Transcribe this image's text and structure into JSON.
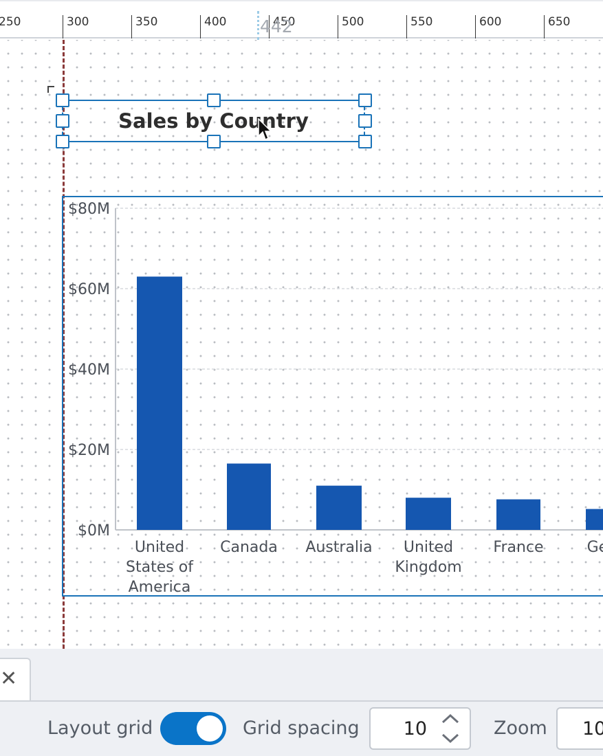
{
  "ruler": {
    "ticks": [
      "250",
      "300",
      "350",
      "400",
      "450",
      "500",
      "550",
      "600",
      "650"
    ],
    "cursor_readout": "442"
  },
  "title_element": {
    "text": "Sales by Country"
  },
  "chart_data": {
    "type": "bar",
    "title": "Sales by Country",
    "categories": [
      "United States of America",
      "Canada",
      "Australia",
      "United Kingdom",
      "France",
      "Germany"
    ],
    "category_lines": [
      [
        "United",
        "States of",
        "America"
      ],
      [
        "Canada"
      ],
      [
        "Australia"
      ],
      [
        "United",
        "Kingdom"
      ],
      [
        "France"
      ],
      [
        "Germ"
      ]
    ],
    "values": [
      63000000,
      16500000,
      11000000,
      8000000,
      7600000,
      5200000
    ],
    "yticks": [
      "$0M",
      "$20M",
      "$40M",
      "$60M",
      "$80M"
    ],
    "ylim": [
      0,
      80000000
    ],
    "grid": true,
    "colors": {
      "bar": "#1557b0",
      "grid": "#d7dade",
      "axis": "#bfc3c9",
      "text": "#4a4f57"
    }
  },
  "bottom_bar": {
    "tab_close_icon": "close-icon",
    "layout_grid_label": "Layout grid",
    "layout_grid_on": true,
    "grid_spacing_label": "Grid spacing",
    "grid_spacing_value": "10",
    "zoom_label": "Zoom",
    "zoom_value": "10"
  },
  "colors": {
    "accent": "#0a74c8",
    "selection": "#1a73b8",
    "guide": "#8b3a3a"
  }
}
